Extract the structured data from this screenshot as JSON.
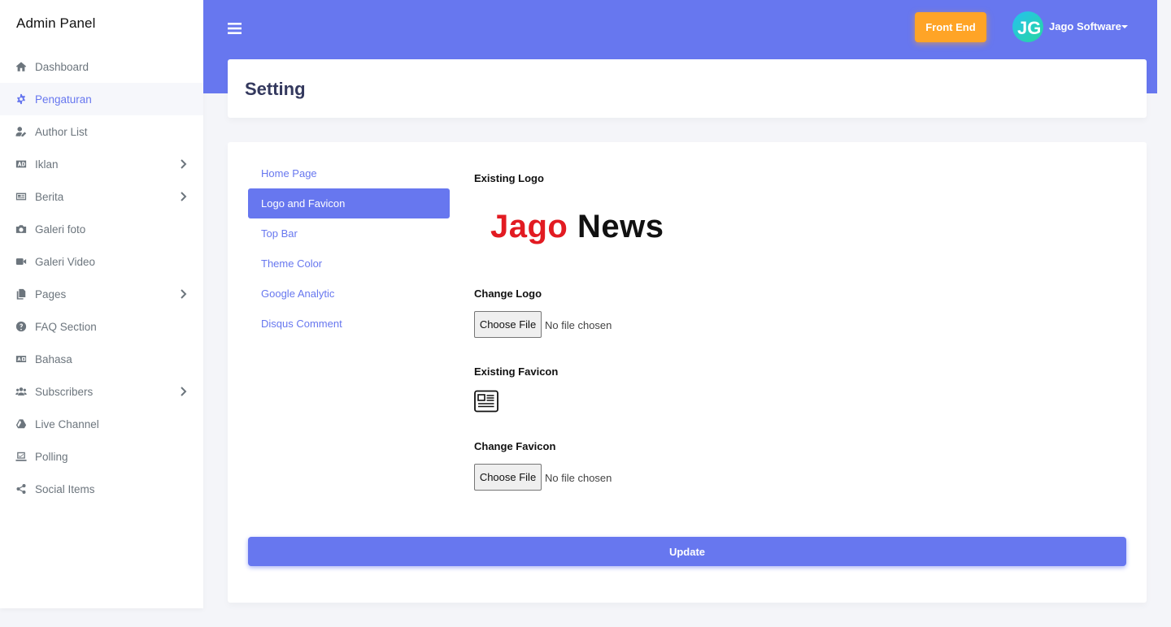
{
  "app": {
    "brand": "Admin Panel"
  },
  "sidebar": {
    "items": [
      {
        "label": "Dashboard",
        "icon": "home-icon",
        "has_submenu": false
      },
      {
        "label": "Pengaturan",
        "icon": "cog-icon",
        "has_submenu": false,
        "active": true
      },
      {
        "label": "Author List",
        "icon": "user-edit-icon",
        "has_submenu": false
      },
      {
        "label": "Iklan",
        "icon": "ad-icon",
        "has_submenu": true
      },
      {
        "label": "Berita",
        "icon": "newspaper-icon",
        "has_submenu": true
      },
      {
        "label": "Galeri foto",
        "icon": "camera-icon",
        "has_submenu": false
      },
      {
        "label": "Galeri Video",
        "icon": "video-icon",
        "has_submenu": false
      },
      {
        "label": "Pages",
        "icon": "copy-icon",
        "has_submenu": true
      },
      {
        "label": "FAQ Section",
        "icon": "question-circle-icon",
        "has_submenu": false
      },
      {
        "label": "Bahasa",
        "icon": "language-icon",
        "has_submenu": false
      },
      {
        "label": "Subscribers",
        "icon": "users-icon",
        "has_submenu": true
      },
      {
        "label": "Live Channel",
        "icon": "drive-icon",
        "has_submenu": false
      },
      {
        "label": "Polling",
        "icon": "poll-icon",
        "has_submenu": false
      },
      {
        "label": "Social Items",
        "icon": "share-icon",
        "has_submenu": false
      }
    ]
  },
  "topbar": {
    "menu_icon": "hamburger-icon",
    "front_end_label": "Front End",
    "user_name": "Jago Software",
    "avatar_initials": "JG"
  },
  "page": {
    "title": "Setting"
  },
  "tabs": [
    {
      "label": "Home Page",
      "active": false
    },
    {
      "label": "Logo and Favicon",
      "active": true
    },
    {
      "label": "Top Bar",
      "active": false
    },
    {
      "label": "Theme Color",
      "active": false
    },
    {
      "label": "Google Analytic",
      "active": false
    },
    {
      "label": "Disqus Comment",
      "active": false
    }
  ],
  "form": {
    "existing_logo_label": "Existing Logo",
    "logo_text_part1": "Jago",
    "logo_text_part2": "News",
    "change_logo_label": "Change Logo",
    "choose_file_label": "Choose File",
    "no_file_text": "No file chosen",
    "existing_favicon_label": "Existing Favicon",
    "favicon_icon": "newspaper-icon",
    "change_favicon_label": "Change Favicon",
    "update_label": "Update"
  },
  "colors": {
    "primary": "#6777ef",
    "warning": "#ffa426",
    "logo_red": "#e21b22",
    "logo_black": "#111111"
  }
}
